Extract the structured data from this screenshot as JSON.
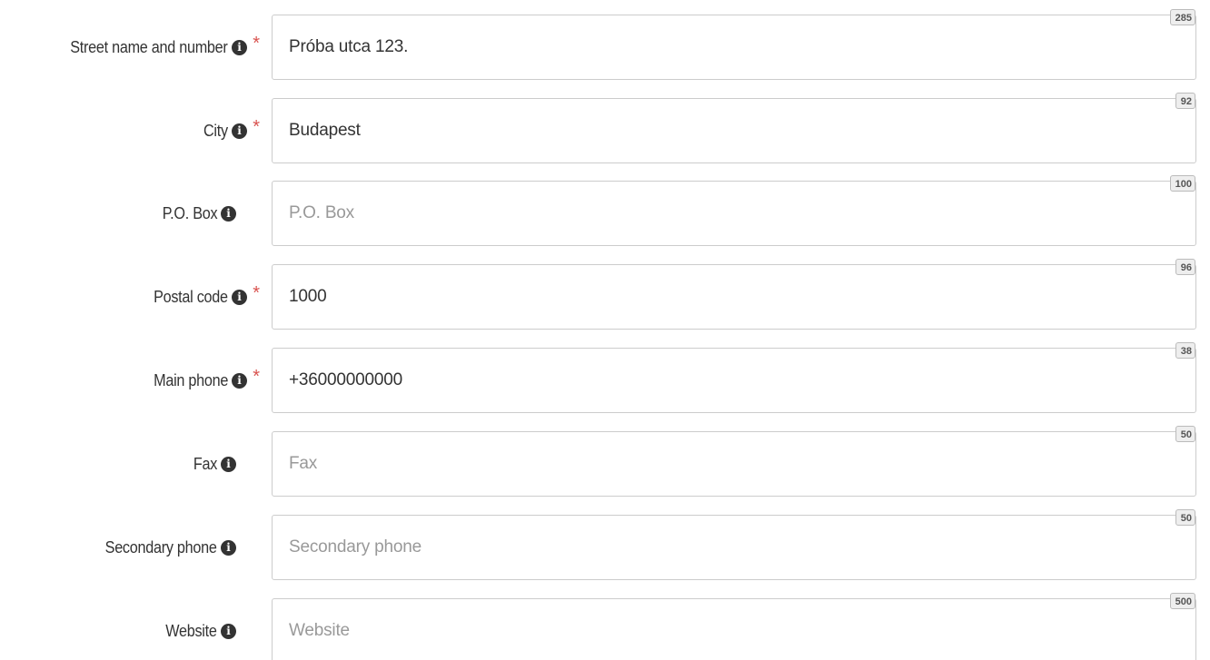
{
  "fields": [
    {
      "label": "Street name and number",
      "required": true,
      "value": "Próba utca 123.",
      "placeholder": "",
      "counter": "285"
    },
    {
      "label": "City",
      "required": true,
      "value": "Budapest",
      "placeholder": "",
      "counter": "92"
    },
    {
      "label": "P.O. Box",
      "required": false,
      "value": "",
      "placeholder": "P.O. Box",
      "counter": "100"
    },
    {
      "label": "Postal code",
      "required": true,
      "value": "1000",
      "placeholder": "",
      "counter": "96"
    },
    {
      "label": "Main phone",
      "required": true,
      "value": "+36000000000",
      "placeholder": "",
      "counter": "38"
    },
    {
      "label": "Fax",
      "required": false,
      "value": "",
      "placeholder": "Fax",
      "counter": "50"
    },
    {
      "label": "Secondary phone",
      "required": false,
      "value": "",
      "placeholder": "Secondary phone",
      "counter": "50"
    },
    {
      "label": "Website",
      "required": false,
      "value": "",
      "placeholder": "Website",
      "counter": "500"
    }
  ],
  "icons": {
    "info": "info-circle-icon",
    "required": "required-asterisk"
  },
  "colors": {
    "required": "#d9534f",
    "border": "#cccccc",
    "text": "#333333",
    "placeholder": "#999999"
  }
}
